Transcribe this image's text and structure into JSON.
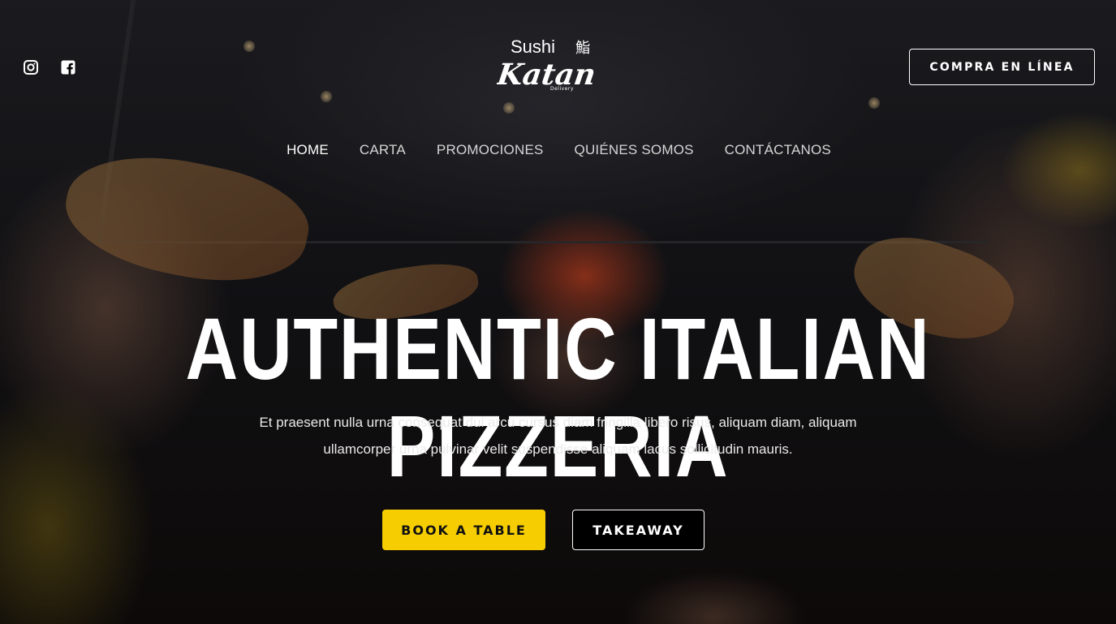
{
  "brand": {
    "logo_top": "Sushi",
    "logo_kanji": "鮨",
    "logo_main": "Katan",
    "logo_sub": "Delivery"
  },
  "social": {
    "icons": [
      "instagram-icon",
      "facebook-icon"
    ]
  },
  "header": {
    "cta_label": "COMPRA EN LÍNEA"
  },
  "nav": {
    "items": [
      {
        "label": "HOME",
        "active": true
      },
      {
        "label": "CARTA",
        "active": false
      },
      {
        "label": "PROMOCIONES",
        "active": false
      },
      {
        "label": "QUIÉNES SOMOS",
        "active": false
      },
      {
        "label": "CONTÁCTANOS",
        "active": false
      }
    ]
  },
  "hero": {
    "title": "AUTHENTIC ITALIAN PIZZERIA",
    "subtitle": "Et praesent nulla urna consequat dui arcu cursus diam fringilla libero risus, aliquam diam, aliquam ullamcorper urna pulvinar velit suspendisse aliquam lacus sollicitudin mauris.",
    "primary_button": "BOOK A TABLE",
    "secondary_button": "TAKEAWAY"
  },
  "colors": {
    "accent": "#f5cd00",
    "text": "#ffffff",
    "background": "#000000"
  }
}
